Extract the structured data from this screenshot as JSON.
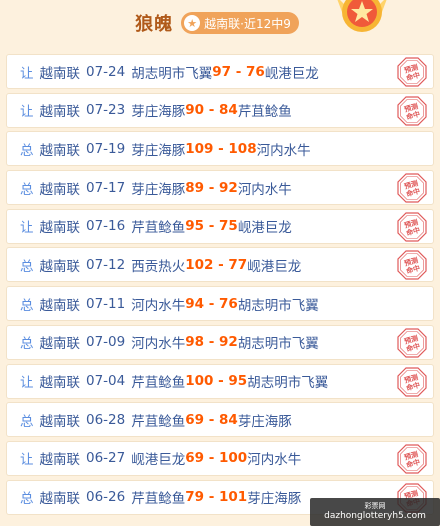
{
  "header": {
    "title": "狼魄",
    "record_badge": "越南联·近12中9",
    "star_icon": "star-icon",
    "medal_icon": "medal-icon"
  },
  "colors": {
    "background": "#fdf1de",
    "title": "#b05a1a",
    "badge": "#f0a35a",
    "tag": "#5b8ee0",
    "text": "#3a5a99",
    "score": "#ff5a00",
    "stamp": "#e05a5a"
  },
  "stamp_text": [
    "预测",
    "命中"
  ],
  "records": [
    {
      "tag": "让",
      "league": "越南联",
      "date": "07-24",
      "home": "胡志明市飞翼",
      "score": "97 - 76",
      "away": "岘港巨龙",
      "hit": true
    },
    {
      "tag": "让",
      "league": "越南联",
      "date": "07-23",
      "home": "芽庄海豚",
      "score": "90 - 84",
      "away": "芹苴鲶鱼",
      "hit": true
    },
    {
      "tag": "总",
      "league": "越南联",
      "date": "07-19",
      "home": "芽庄海豚",
      "score": "109 - 108",
      "away": "河内水牛",
      "hit": false
    },
    {
      "tag": "总",
      "league": "越南联",
      "date": "07-17",
      "home": "芽庄海豚",
      "score": "89 - 92",
      "away": "河内水牛",
      "hit": true
    },
    {
      "tag": "让",
      "league": "越南联",
      "date": "07-16",
      "home": "芹苴鲶鱼",
      "score": "95 - 75",
      "away": "岘港巨龙",
      "hit": true
    },
    {
      "tag": "总",
      "league": "越南联",
      "date": "07-12",
      "home": "西贡热火",
      "score": "102 - 77",
      "away": "岘港巨龙",
      "hit": true
    },
    {
      "tag": "总",
      "league": "越南联",
      "date": "07-11",
      "home": "河内水牛",
      "score": "94 - 76",
      "away": "胡志明市飞翼",
      "hit": false
    },
    {
      "tag": "总",
      "league": "越南联",
      "date": "07-09",
      "home": "河内水牛",
      "score": "98 - 92",
      "away": "胡志明市飞翼",
      "hit": true
    },
    {
      "tag": "让",
      "league": "越南联",
      "date": "07-04",
      "home": "芹苴鲶鱼",
      "score": "100 - 95",
      "away": "胡志明市飞翼",
      "hit": true
    },
    {
      "tag": "总",
      "league": "越南联",
      "date": "06-28",
      "home": "芹苴鲶鱼",
      "score": "69 - 84",
      "away": "芽庄海豚",
      "hit": false
    },
    {
      "tag": "让",
      "league": "越南联",
      "date": "06-27",
      "home": "岘港巨龙",
      "score": "69 - 100",
      "away": "河内水牛",
      "hit": true
    },
    {
      "tag": "总",
      "league": "越南联",
      "date": "06-26",
      "home": "芹苴鲶鱼",
      "score": "79 - 101",
      "away": "芽庄海豚",
      "hit": true
    }
  ],
  "watermark": {
    "top": "彩票网",
    "url": "dazhonglotteryh5.com"
  }
}
